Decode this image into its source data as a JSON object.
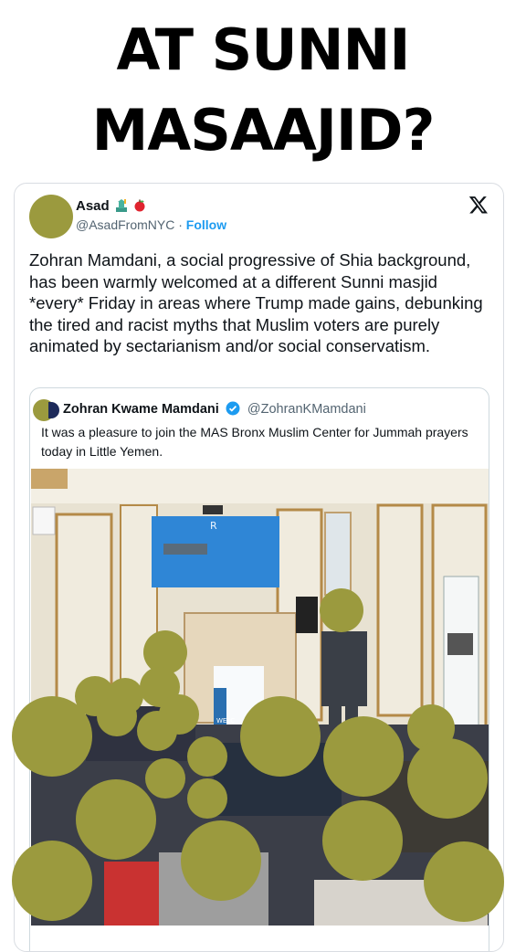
{
  "headline": {
    "line1": "AT SUNNI",
    "line2": "MASAAJID?"
  },
  "tweet": {
    "author": "Asad",
    "handle": "@AsadFromNYC",
    "separator": "·",
    "follow_label": "Follow",
    "body": "Zohran Mamdani, a social progressive of Shia background, has been warmly welcomed at a different Sunni masjid *every* Friday in areas where Trump made gains, debunking the tired and racist myths that Muslim voters are purely animated by sectarianism and/or social conservatism.",
    "name_emojis": [
      "statue-of-liberty-icon",
      "apple-icon"
    ]
  },
  "quoted_tweet": {
    "author": "Zohran Kwame Mamdani",
    "handle": "@ZohranKMamdani",
    "verified": true,
    "text": "It was a pleasure to join the MAS Bronx Muslim Center for Jummah prayers today in Little Yemen."
  },
  "photo": {
    "screen_text": "R",
    "banner_text": "WELC",
    "accent_colors": {
      "screen": "#2f86d6",
      "wall": "#eae4d4",
      "redaction": "#9b9a3e"
    }
  },
  "colors": {
    "link": "#1d9bf0",
    "text": "#0f1419",
    "muted": "#536471"
  }
}
